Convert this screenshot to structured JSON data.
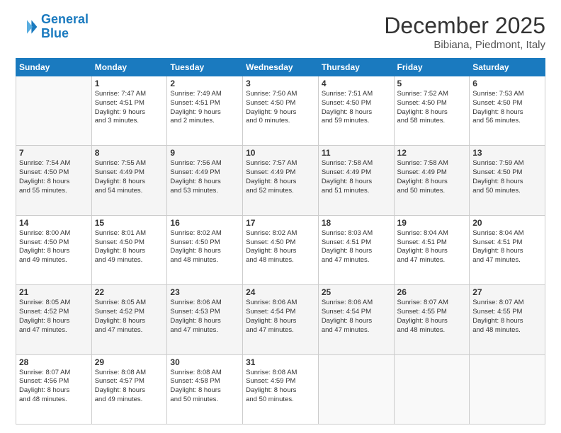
{
  "logo": {
    "line1": "General",
    "line2": "Blue"
  },
  "title": "December 2025",
  "location": "Bibiana, Piedmont, Italy",
  "weekdays": [
    "Sunday",
    "Monday",
    "Tuesday",
    "Wednesday",
    "Thursday",
    "Friday",
    "Saturday"
  ],
  "weeks": [
    [
      {
        "day": "",
        "info": ""
      },
      {
        "day": "1",
        "info": "Sunrise: 7:47 AM\nSunset: 4:51 PM\nDaylight: 9 hours\nand 3 minutes."
      },
      {
        "day": "2",
        "info": "Sunrise: 7:49 AM\nSunset: 4:51 PM\nDaylight: 9 hours\nand 2 minutes."
      },
      {
        "day": "3",
        "info": "Sunrise: 7:50 AM\nSunset: 4:50 PM\nDaylight: 9 hours\nand 0 minutes."
      },
      {
        "day": "4",
        "info": "Sunrise: 7:51 AM\nSunset: 4:50 PM\nDaylight: 8 hours\nand 59 minutes."
      },
      {
        "day": "5",
        "info": "Sunrise: 7:52 AM\nSunset: 4:50 PM\nDaylight: 8 hours\nand 58 minutes."
      },
      {
        "day": "6",
        "info": "Sunrise: 7:53 AM\nSunset: 4:50 PM\nDaylight: 8 hours\nand 56 minutes."
      }
    ],
    [
      {
        "day": "7",
        "info": "Sunrise: 7:54 AM\nSunset: 4:50 PM\nDaylight: 8 hours\nand 55 minutes."
      },
      {
        "day": "8",
        "info": "Sunrise: 7:55 AM\nSunset: 4:49 PM\nDaylight: 8 hours\nand 54 minutes."
      },
      {
        "day": "9",
        "info": "Sunrise: 7:56 AM\nSunset: 4:49 PM\nDaylight: 8 hours\nand 53 minutes."
      },
      {
        "day": "10",
        "info": "Sunrise: 7:57 AM\nSunset: 4:49 PM\nDaylight: 8 hours\nand 52 minutes."
      },
      {
        "day": "11",
        "info": "Sunrise: 7:58 AM\nSunset: 4:49 PM\nDaylight: 8 hours\nand 51 minutes."
      },
      {
        "day": "12",
        "info": "Sunrise: 7:58 AM\nSunset: 4:49 PM\nDaylight: 8 hours\nand 50 minutes."
      },
      {
        "day": "13",
        "info": "Sunrise: 7:59 AM\nSunset: 4:50 PM\nDaylight: 8 hours\nand 50 minutes."
      }
    ],
    [
      {
        "day": "14",
        "info": "Sunrise: 8:00 AM\nSunset: 4:50 PM\nDaylight: 8 hours\nand 49 minutes."
      },
      {
        "day": "15",
        "info": "Sunrise: 8:01 AM\nSunset: 4:50 PM\nDaylight: 8 hours\nand 49 minutes."
      },
      {
        "day": "16",
        "info": "Sunrise: 8:02 AM\nSunset: 4:50 PM\nDaylight: 8 hours\nand 48 minutes."
      },
      {
        "day": "17",
        "info": "Sunrise: 8:02 AM\nSunset: 4:50 PM\nDaylight: 8 hours\nand 48 minutes."
      },
      {
        "day": "18",
        "info": "Sunrise: 8:03 AM\nSunset: 4:51 PM\nDaylight: 8 hours\nand 47 minutes."
      },
      {
        "day": "19",
        "info": "Sunrise: 8:04 AM\nSunset: 4:51 PM\nDaylight: 8 hours\nand 47 minutes."
      },
      {
        "day": "20",
        "info": "Sunrise: 8:04 AM\nSunset: 4:51 PM\nDaylight: 8 hours\nand 47 minutes."
      }
    ],
    [
      {
        "day": "21",
        "info": "Sunrise: 8:05 AM\nSunset: 4:52 PM\nDaylight: 8 hours\nand 47 minutes."
      },
      {
        "day": "22",
        "info": "Sunrise: 8:05 AM\nSunset: 4:52 PM\nDaylight: 8 hours\nand 47 minutes."
      },
      {
        "day": "23",
        "info": "Sunrise: 8:06 AM\nSunset: 4:53 PM\nDaylight: 8 hours\nand 47 minutes."
      },
      {
        "day": "24",
        "info": "Sunrise: 8:06 AM\nSunset: 4:54 PM\nDaylight: 8 hours\nand 47 minutes."
      },
      {
        "day": "25",
        "info": "Sunrise: 8:06 AM\nSunset: 4:54 PM\nDaylight: 8 hours\nand 47 minutes."
      },
      {
        "day": "26",
        "info": "Sunrise: 8:07 AM\nSunset: 4:55 PM\nDaylight: 8 hours\nand 48 minutes."
      },
      {
        "day": "27",
        "info": "Sunrise: 8:07 AM\nSunset: 4:55 PM\nDaylight: 8 hours\nand 48 minutes."
      }
    ],
    [
      {
        "day": "28",
        "info": "Sunrise: 8:07 AM\nSunset: 4:56 PM\nDaylight: 8 hours\nand 48 minutes."
      },
      {
        "day": "29",
        "info": "Sunrise: 8:08 AM\nSunset: 4:57 PM\nDaylight: 8 hours\nand 49 minutes."
      },
      {
        "day": "30",
        "info": "Sunrise: 8:08 AM\nSunset: 4:58 PM\nDaylight: 8 hours\nand 50 minutes."
      },
      {
        "day": "31",
        "info": "Sunrise: 8:08 AM\nSunset: 4:59 PM\nDaylight: 8 hours\nand 50 minutes."
      },
      {
        "day": "",
        "info": ""
      },
      {
        "day": "",
        "info": ""
      },
      {
        "day": "",
        "info": ""
      }
    ]
  ]
}
